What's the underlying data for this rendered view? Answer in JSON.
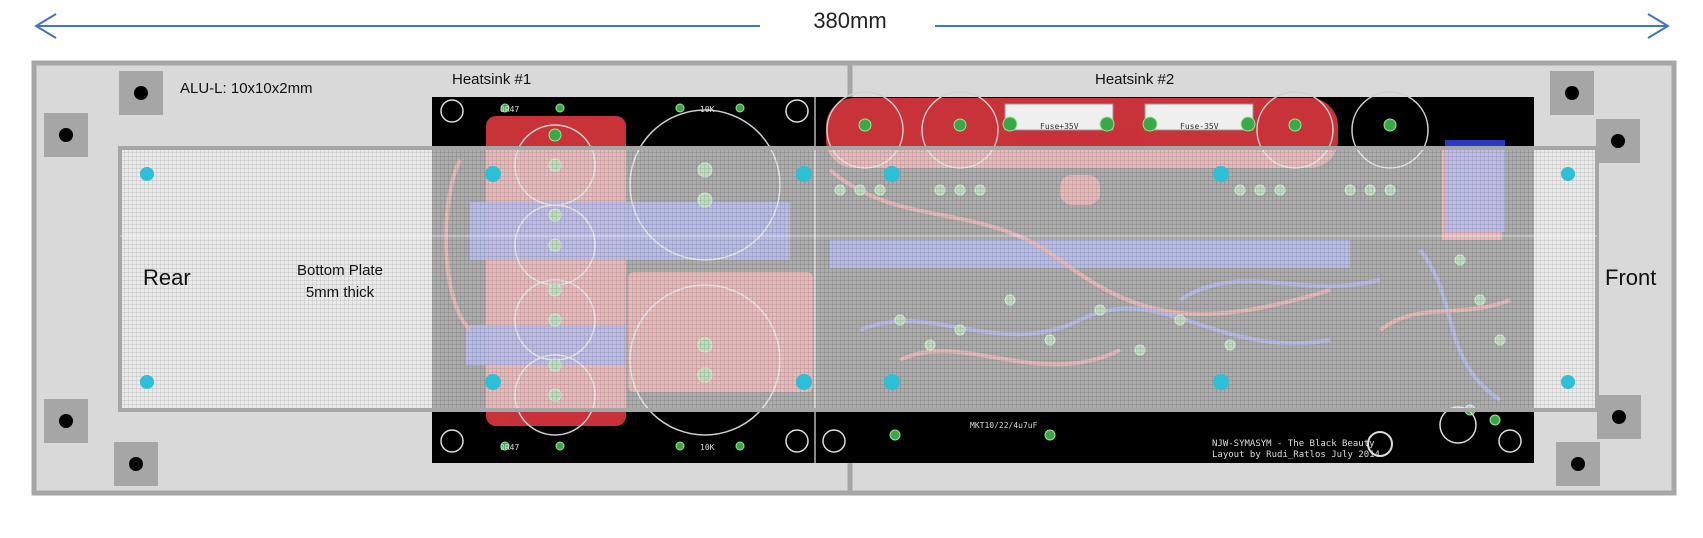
{
  "dimension": {
    "text": "380mm"
  },
  "labels": {
    "alu": "ALU-L: 10x10x2mm",
    "heatsink1": "Heatsink #1",
    "heatsink2": "Heatsink #2",
    "rear": "Rear",
    "front": "Front",
    "bottom_plate_line1": "Bottom Plate",
    "bottom_plate_line2": "5mm thick"
  },
  "pcb": {
    "title_line1": "NJW-SYMASYM - The Black Beauty",
    "title_line2": "Layout by Rudi_Ratlos July 2014",
    "resistor_r1": "0R47",
    "resistor_r2": "0R47",
    "resistor_r3": "10K",
    "resistor_r4": "10K",
    "cap_label": "MKT10/22/4u7uF",
    "fuse_a": "Fuse+35V",
    "fuse_b": "Fuse-35V"
  },
  "colors": {
    "arrow": "#4472c4",
    "frame": "#a6a6a6",
    "frame_fill": "#d9d9d9",
    "pcb_black": "#000000",
    "copper_top": "#d9363e",
    "copper_bottom": "#2e3fd6",
    "pad": "#3aa845",
    "mount_hole": "#2bc0d6"
  }
}
